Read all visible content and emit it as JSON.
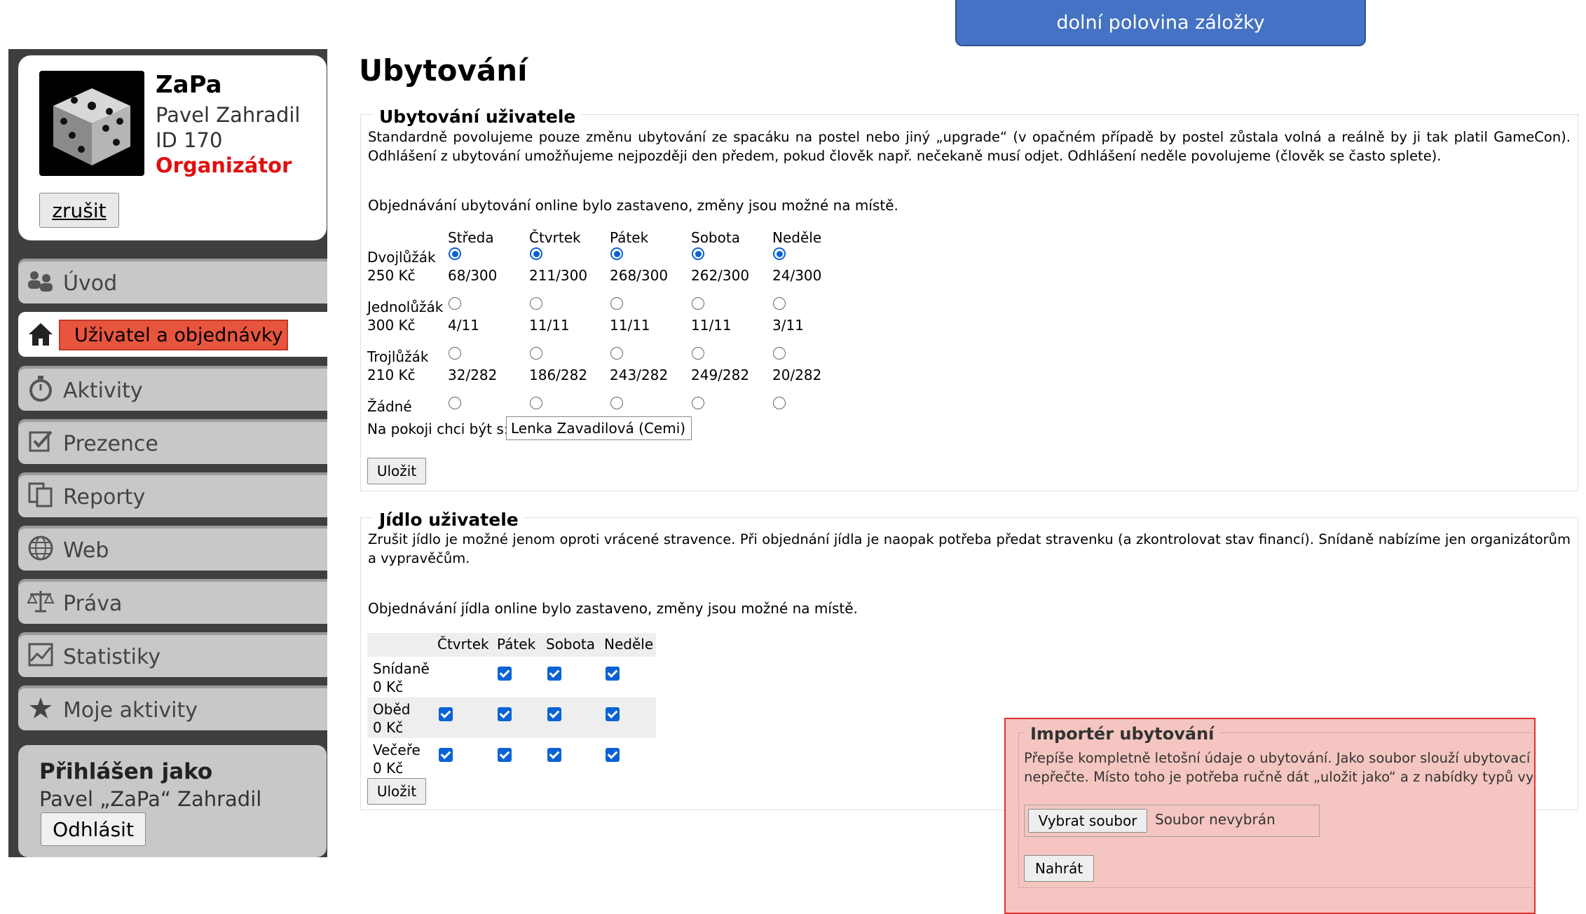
{
  "banner": {
    "text": "dolní polovina záložky"
  },
  "user_card": {
    "nick": "ZaPa",
    "full_name": "Pavel Zahradil",
    "id": "ID 170",
    "role": "Organizátor",
    "cancel_label": "zrušit",
    "avatar_icon": "dice-icon"
  },
  "menu": {
    "items": [
      {
        "label": "Úvod",
        "icon": "users-icon"
      },
      {
        "label": "Uživatel a objednávky",
        "icon": "home-icon"
      },
      {
        "label": "Aktivity",
        "icon": "stopwatch-icon"
      },
      {
        "label": "Prezence",
        "icon": "checkbox-icon"
      },
      {
        "label": "Reporty",
        "icon": "copy-icon"
      },
      {
        "label": "Web",
        "icon": "globe-icon"
      },
      {
        "label": "Práva",
        "icon": "scale-icon"
      },
      {
        "label": "Statistiky",
        "icon": "chart-icon"
      },
      {
        "label": "Moje aktivity",
        "icon": "star-icon"
      }
    ]
  },
  "login": {
    "title": "Přihlášen jako",
    "user": "Pavel „ZaPa“ Zahradil",
    "logout_label": "Odhlásit"
  },
  "page": {
    "title": "Ubytování"
  },
  "accommodation": {
    "legend": "Ubytování uživatele",
    "description": "Standardně povolujeme pouze změnu ubytování ze spacáku na postel nebo jiný „upgrade“ (v opačném případě by postel zůstala volná a reálně by ji tak platil GameCon). Odhlášení z ubytování umožňujeme nejpozději den předem, pokud člověk např. nečekaně musí odjet. Odhlášení neděle povolujeme (člověk se často splete).",
    "notice": "Objednávání ubytování online bylo zastaveno, změny jsou možné na místě.",
    "days": [
      "Středa",
      "Čtvrtek",
      "Pátek",
      "Sobota",
      "Neděle"
    ],
    "rows": [
      {
        "name": "Dvojlůžák",
        "price": "250 Kč",
        "counts": [
          "68/300",
          "211/300",
          "268/300",
          "262/300",
          "24/300"
        ],
        "selected": true
      },
      {
        "name": "Jednolůžák",
        "price": "300 Kč",
        "counts": [
          "4/11",
          "11/11",
          "11/11",
          "11/11",
          "3/11"
        ],
        "selected": false
      },
      {
        "name": "Trojlůžák",
        "price": "210 Kč",
        "counts": [
          "32/282",
          "186/282",
          "243/282",
          "249/282",
          "20/282"
        ],
        "selected": false
      },
      {
        "name": "Žádné",
        "price": "",
        "counts": [
          "",
          "",
          "",
          "",
          ""
        ],
        "selected": false
      }
    ],
    "roommate_label": "Na pokoji chci být s:",
    "roommate_value": "Lenka Zavadilová (Cemi),",
    "save_label": "Uložit"
  },
  "food": {
    "legend": "Jídlo uživatele",
    "description": "Zrušit jídlo je možné jenom oproti vrácené stravence. Při objednání jídla je naopak potřeba předat stravenku (a zkontrolovat stav financí). Snídaně nabízíme jen organizátorům a vypravěčům.",
    "notice": "Objednávání jídla online bylo zastaveno, změny jsou možné na místě.",
    "days": [
      "Čtvrtek",
      "Pátek",
      "Sobota",
      "Neděle"
    ],
    "rows": [
      {
        "name": "Snídaně",
        "price": "0 Kč",
        "checked": [
          false,
          true,
          true,
          true
        ]
      },
      {
        "name": "Oběd",
        "price": "0 Kč",
        "checked": [
          true,
          true,
          true,
          true
        ]
      },
      {
        "name": "Večeře",
        "price": "0 Kč",
        "checked": [
          true,
          true,
          true,
          true
        ]
      }
    ],
    "save_label": "Uložit"
  },
  "importer": {
    "legend": "Importér ubytování",
    "text_line1": "Přepíše kompletně letošní údaje o ubytování. Jako soubor slouží ubytovací",
    "text_line2": "nepřečte. Místo toho je potřeba ručně dát „uložit jako“ a z nabídky typů vy",
    "choose_label": "Vybrat soubor",
    "no_file": "Soubor nevybrán",
    "upload_label": "Nahrát"
  },
  "colors": {
    "banner": "#4472c4",
    "sidebar": "#3f3f3f",
    "accent_red": "#e01010",
    "highlight": "#e8553e",
    "importer_bg": "#f5c6c1",
    "control_blue": "#0b62d6"
  }
}
